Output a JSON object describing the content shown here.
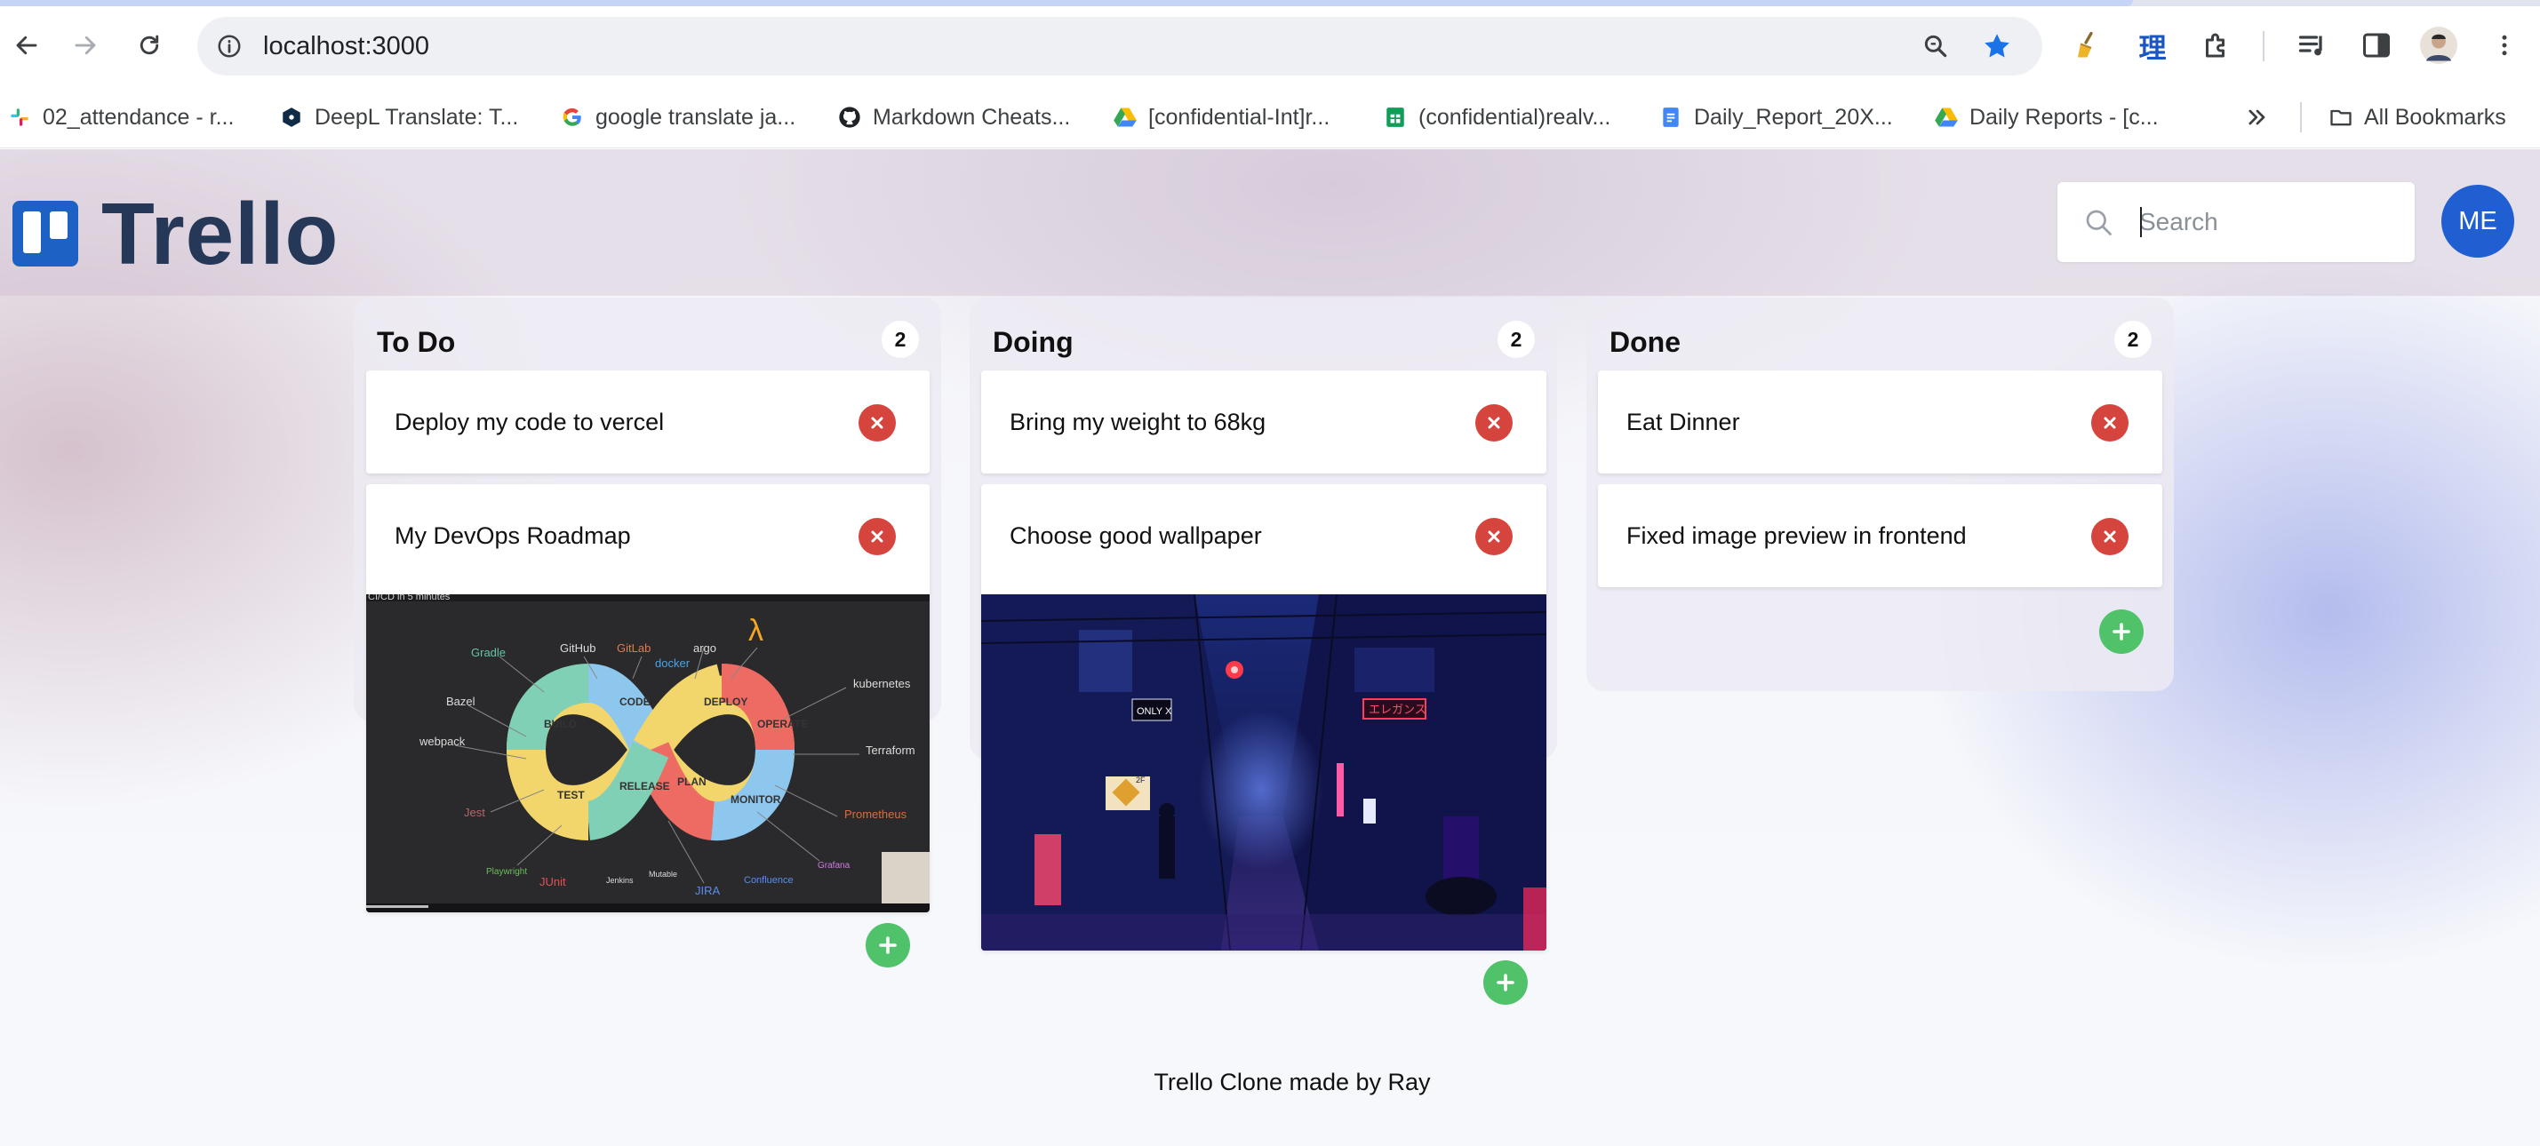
{
  "browser": {
    "url": "localhost:3000",
    "bookmarks": [
      {
        "label": "02_attendance - r...",
        "icon": "slack-icon"
      },
      {
        "label": "DeepL Translate: T...",
        "icon": "deepl-icon"
      },
      {
        "label": "google translate ja...",
        "icon": "google-icon"
      },
      {
        "label": "Markdown Cheats...",
        "icon": "github-icon"
      },
      {
        "label": "[confidential-Int]r...",
        "icon": "google-drive-icon"
      },
      {
        "label": "(confidential)realv...",
        "icon": "google-sheets-icon"
      },
      {
        "label": "Daily_Report_20X...",
        "icon": "google-docs-icon"
      },
      {
        "label": "Daily Reports - [c...",
        "icon": "google-drive-icon"
      }
    ],
    "all_bookmarks_label": "All Bookmarks",
    "ext_kanji": "理"
  },
  "app": {
    "logo_text": "Trello",
    "search_placeholder": "Search",
    "avatar_initials": "ME",
    "footer_text": "Trello Clone made by Ray"
  },
  "columns": [
    {
      "title": "To Do",
      "count": "2",
      "cards": [
        {
          "text": "Deploy my code to vercel"
        },
        {
          "text": "My DevOps Roadmap",
          "image_caption": "CI/CD in 5 minutes",
          "image_labels": [
            "BUILD",
            "CODE",
            "DEPLOY",
            "OPERATE",
            "TEST",
            "RELEASE",
            "PLAN",
            "MONITOR",
            "Gradle",
            "GitHub",
            "GitLab",
            "argo",
            "docker",
            "λ",
            "kubernetes",
            "Bazel",
            "Terraform",
            "webpack",
            "Jest",
            "Prometheus",
            "Playwright",
            "JUnit",
            "Jenkins",
            "Mutable",
            "JIRA",
            "Confluence",
            "Grafana"
          ]
        }
      ]
    },
    {
      "title": "Doing",
      "count": "2",
      "cards": [
        {
          "text": "Bring my weight to 68kg"
        },
        {
          "text": "Choose good wallpaper",
          "image_signs": [
            "ONLY X",
            "エレガンス",
            "2F"
          ]
        }
      ]
    },
    {
      "title": "Done",
      "count": "2",
      "cards": [
        {
          "text": "Eat Dinner"
        },
        {
          "text": "Fixed image preview in frontend"
        }
      ]
    }
  ],
  "colors": {
    "delete": "#d6453d",
    "add": "#4fc26a",
    "brand": "#1e61c4",
    "avatar": "#1f5fd1"
  }
}
